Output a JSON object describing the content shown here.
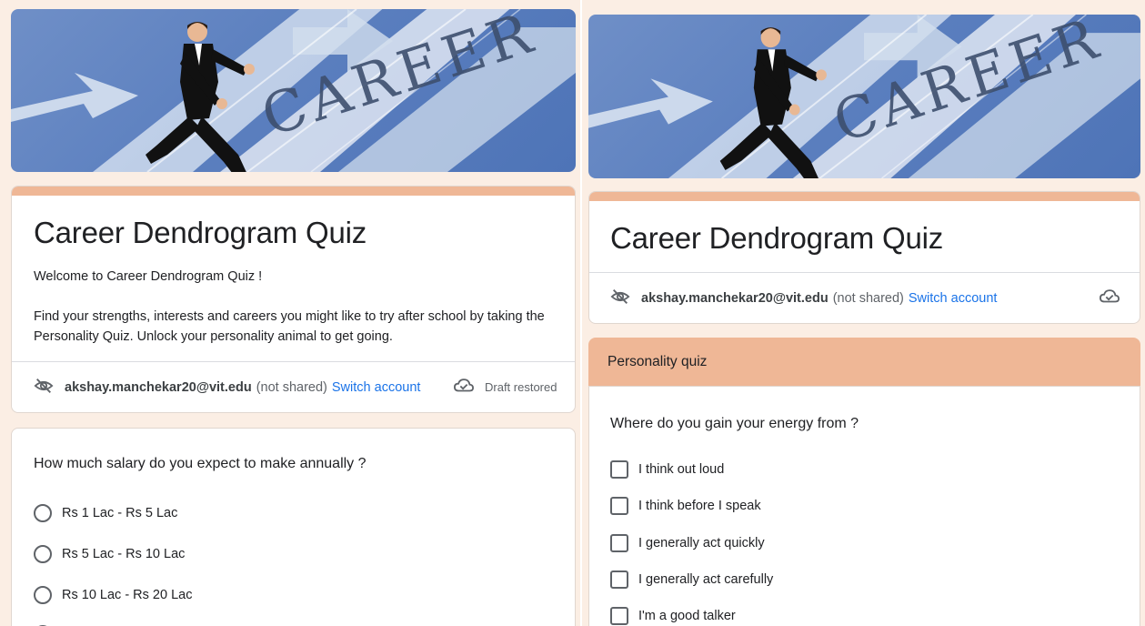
{
  "left": {
    "form_title": "Career Dendrogram Quiz",
    "welcome": "Welcome to Career Dendrogram Quiz !",
    "description": "Find your strengths, interests and careers you might like to try after school by taking the Personality Quiz. Unlock your personality animal to get going.",
    "account": {
      "email": "akshay.manchekar20@vit.edu",
      "not_shared": "(not shared)",
      "switch": "Switch account",
      "status": "Draft restored"
    },
    "question": "How much salary do you expect to make annually ?",
    "options": [
      "Rs 1 Lac - Rs 5 Lac",
      "Rs 5 Lac - Rs 10 Lac",
      "Rs 10 Lac - Rs 20 Lac"
    ]
  },
  "right": {
    "form_title": "Career Dendrogram Quiz",
    "account": {
      "email": "akshay.manchekar20@vit.edu",
      "not_shared": "(not shared)",
      "switch": "Switch account"
    },
    "section_title": "Personality quiz",
    "question": "Where do you gain your energy from ?",
    "options": [
      "I think out loud",
      "I think before I speak",
      "I generally act quickly",
      "I generally act carefully",
      "I'm a good talker"
    ]
  },
  "banner_text": "CAREER",
  "colors": {
    "accent": "#efb796",
    "link": "#1a73e8",
    "background": "#fbeee4"
  }
}
